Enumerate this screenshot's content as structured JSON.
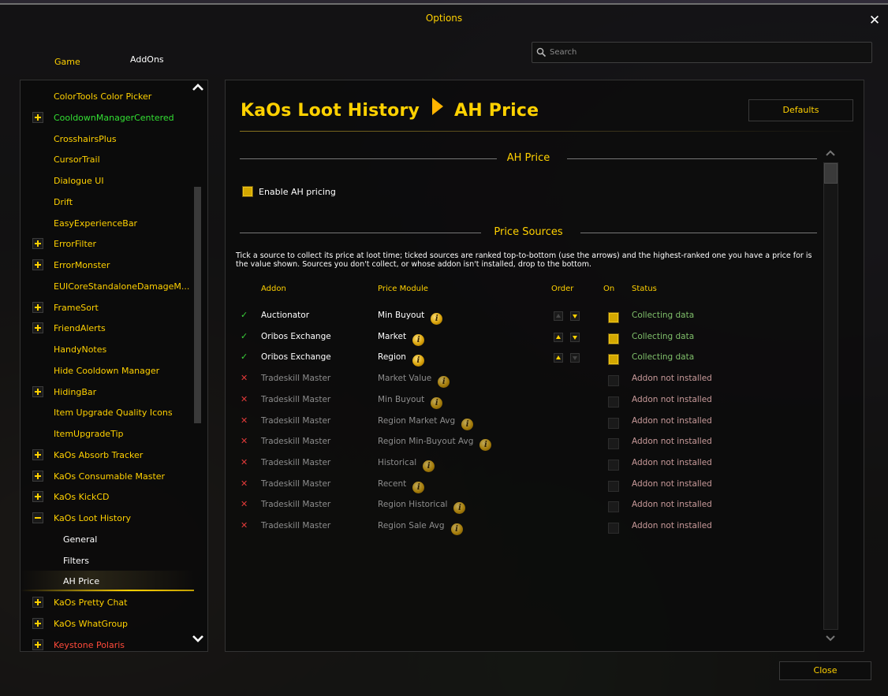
{
  "window": {
    "title": "Options"
  },
  "tabs": {
    "game": "Game",
    "addons": "AddOns"
  },
  "search": {
    "placeholder": "Search"
  },
  "sidebar": {
    "items": [
      {
        "label": "ColorTools Color Picker",
        "expander": "none",
        "color": "#ffd100"
      },
      {
        "label": "CooldownManagerCentered",
        "expander": "plus",
        "color": "#33e033"
      },
      {
        "label": "CrosshairsPlus",
        "expander": "none",
        "color": "#ffd100"
      },
      {
        "label": "CursorTrail",
        "expander": "none",
        "color": "#ffd100"
      },
      {
        "label": "Dialogue UI",
        "expander": "none",
        "color": "#ffd100"
      },
      {
        "label": "Drift",
        "expander": "none",
        "color": "#ffd100"
      },
      {
        "label": "EasyExperienceBar",
        "expander": "none",
        "color": "#ffd100"
      },
      {
        "label": "ErrorFilter",
        "expander": "plus",
        "color": "#ffd100"
      },
      {
        "label": "ErrorMonster",
        "expander": "plus",
        "color": "#ffd100"
      },
      {
        "label": "EUICoreStandaloneDamageM...",
        "expander": "none",
        "color": "#ffd100"
      },
      {
        "label": "FrameSort",
        "expander": "plus",
        "color": "#ffd100"
      },
      {
        "label": "FriendAlerts",
        "expander": "plus",
        "color": "#ffd100"
      },
      {
        "label": "HandyNotes",
        "expander": "none",
        "color": "#ffd100"
      },
      {
        "label": "Hide Cooldown Manager",
        "expander": "none",
        "color": "#ffd100"
      },
      {
        "label": "HidingBar",
        "expander": "plus",
        "color": "#ffd100"
      },
      {
        "label": "Item Upgrade Quality Icons",
        "expander": "none",
        "color": "#ffd100"
      },
      {
        "label": "ItemUpgradeTip",
        "expander": "none",
        "color": "#ffd100"
      },
      {
        "label": "KaOs Absorb Tracker",
        "expander": "plus",
        "color": "#ffd100"
      },
      {
        "label": "KaOs Consumable Master",
        "expander": "plus",
        "color": "#ffd100"
      },
      {
        "label": "KaOs KickCD",
        "expander": "plus",
        "color": "#ffd100"
      },
      {
        "label": "KaOs Loot History",
        "expander": "minus",
        "color": "#ffd100"
      },
      {
        "label": "General",
        "expander": "sub",
        "color": "#ffffff"
      },
      {
        "label": "Filters",
        "expander": "sub",
        "color": "#ffffff"
      },
      {
        "label": "AH Price",
        "expander": "sub-selected",
        "color": "#ffffff"
      },
      {
        "label": "KaOs Pretty Chat",
        "expander": "plus",
        "color": "#ffd100"
      },
      {
        "label": "KaOs WhatGroup",
        "expander": "plus",
        "color": "#ffd100"
      },
      {
        "label": "Keystone Polaris",
        "expander": "plus",
        "color": "#ff4a3a"
      }
    ]
  },
  "breadcrumb": {
    "parent": "KaOs Loot History",
    "current": "AH Price"
  },
  "buttons": {
    "defaults": "Defaults",
    "close": "Close"
  },
  "ah_section": {
    "title": "AH Price",
    "enable_label": "Enable AH pricing",
    "enabled": true
  },
  "sources_section": {
    "title": "Price Sources",
    "description": "Tick a source to collect its price at loot time; ticked sources are ranked top-to-bottom (use the arrows) and the highest-ranked one you have a price for is the value shown. Sources you don't collect, or whose addon isn't installed, drop to the bottom.",
    "columns": {
      "addon": "Addon",
      "module": "Price Module",
      "order": "Order",
      "on": "On",
      "status": "Status"
    },
    "rows": [
      {
        "mark": "✓",
        "installed": true,
        "addon": "Auctionator",
        "module": "Min Buyout",
        "on": true,
        "up": false,
        "down": true,
        "status": "Collecting data"
      },
      {
        "mark": "✓",
        "installed": true,
        "addon": "Oribos Exchange",
        "module": "Market",
        "on": true,
        "up": true,
        "down": true,
        "status": "Collecting data"
      },
      {
        "mark": "✓",
        "installed": true,
        "addon": "Oribos Exchange",
        "module": "Region",
        "on": true,
        "up": true,
        "down": false,
        "status": "Collecting data"
      },
      {
        "mark": "✕",
        "installed": false,
        "addon": "Tradeskill Master",
        "module": "Market Value",
        "on": false,
        "status": "Addon not installed"
      },
      {
        "mark": "✕",
        "installed": false,
        "addon": "Tradeskill Master",
        "module": "Min Buyout",
        "on": false,
        "status": "Addon not installed"
      },
      {
        "mark": "✕",
        "installed": false,
        "addon": "Tradeskill Master",
        "module": "Region Market Avg",
        "on": false,
        "status": "Addon not installed"
      },
      {
        "mark": "✕",
        "installed": false,
        "addon": "Tradeskill Master",
        "module": "Region Min-Buyout Avg",
        "on": false,
        "status": "Addon not installed"
      },
      {
        "mark": "✕",
        "installed": false,
        "addon": "Tradeskill Master",
        "module": "Historical",
        "on": false,
        "status": "Addon not installed"
      },
      {
        "mark": "✕",
        "installed": false,
        "addon": "Tradeskill Master",
        "module": "Recent",
        "on": false,
        "status": "Addon not installed"
      },
      {
        "mark": "✕",
        "installed": false,
        "addon": "Tradeskill Master",
        "module": "Region Historical",
        "on": false,
        "status": "Addon not installed"
      },
      {
        "mark": "✕",
        "installed": false,
        "addon": "Tradeskill Master",
        "module": "Region Sale Avg",
        "on": false,
        "status": "Addon not installed"
      }
    ]
  },
  "icons": {
    "close": "close-icon",
    "search": "search-icon",
    "breadcrumb_separator": "arrow-right-icon",
    "info": "info-icon",
    "info_glyph": "i",
    "scroll_up": "chevron-up-icon",
    "scroll_down": "chevron-down-icon"
  },
  "colors": {
    "accent": "#ffd100",
    "collecting": "#7fbf6a",
    "missing": "#c89a9a"
  }
}
